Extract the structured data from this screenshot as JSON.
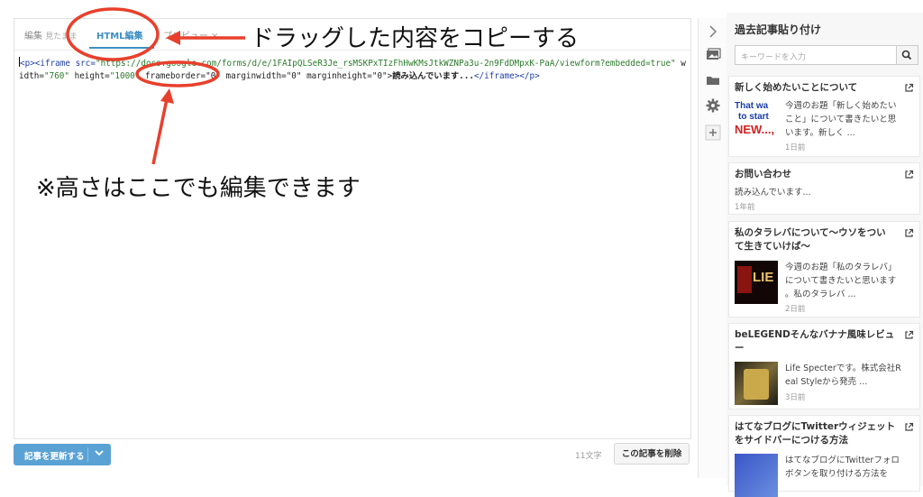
{
  "editor": {
    "tabs": [
      {
        "label": "編集",
        "sub": "見たまま"
      },
      {
        "label": "HTML編集"
      },
      {
        "label": "プレビュー",
        "close": "×"
      }
    ],
    "code": {
      "p_open": "<p>",
      "iframe_open": "<iframe src=",
      "src_value": "\"https://docs.google.com/forms/d/e/1FAIpQLSeR3Je_rsMSKPxTIzFhHwKMsJtkWZNPa3u-2n9FdDMpxK-PaA/viewform?embedded=true\"",
      "width_attr": " width=",
      "width_value": "\"760\"",
      "height_attr": " height=",
      "height_value": "\"1000\"",
      "frameborder": " frameborder=\"0\" marginwidth=\"0\" marginheight=\"0\">",
      "inner_text": "読み込んでいます...",
      "close_tags": "</iframe></p>"
    },
    "update_button": "記事を更新する",
    "char_count": "11文字",
    "delete_button": "この記事を削除"
  },
  "annotations": {
    "drag_note": "ドラッグした内容をコピーする",
    "height_note": "※高さはここでも編集できます",
    "arrow_color": "#e8402c"
  },
  "sidebar": {
    "title": "過去記事貼り付け",
    "search_placeholder": "キーワードを入力",
    "articles": [
      {
        "title": "新しく始めたいことについて",
        "excerpt": [
          "今週のお題「新しく始めたい",
          "こと」について書きたいと思",
          "います。新しく ..."
        ],
        "ago": "1日前",
        "thumb_text": [
          "That wa",
          "to start",
          "NEW...,"
        ]
      },
      {
        "title": "お問い合わせ",
        "excerpt": [
          "読み込んでいます..."
        ],
        "ago": "1年前"
      },
      {
        "title": "私のタラレバについて〜ウソをつい",
        "title2": "て生きていけば〜",
        "excerpt": [
          "今週のお題「私のタラレバ」",
          "について書きたいと思います",
          "。私のタラレバ ..."
        ],
        "ago": "2日前",
        "thumb_text": [
          "LIE"
        ]
      },
      {
        "title": "beLEGENDそんなバナナ風味レビュ",
        "title2": "ー",
        "excerpt": [
          "Life Specterです。株式会社R",
          "eal Styleから発売 ..."
        ],
        "ago": "3日前"
      },
      {
        "title": "はてなブログにTwitterウィジェット",
        "title2": "をサイドバーにつける方法",
        "excerpt": [
          "はてなブログにTwitterフォロ",
          "ボタンを取り付ける方法を"
        ]
      }
    ]
  }
}
